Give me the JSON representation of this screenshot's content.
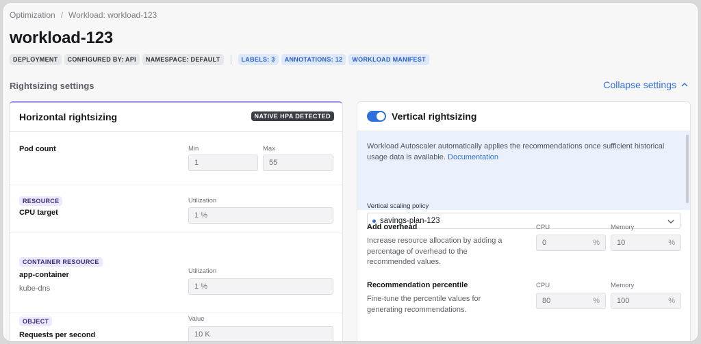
{
  "breadcrumb": {
    "root": "Optimization",
    "separator": "/",
    "current": "Workload: workload-123"
  },
  "title": "workload-123",
  "tags": [
    "DEPLOYMENT",
    "CONFIGURED BY: API",
    "NAMESPACE: DEFAULT"
  ],
  "link_tags": [
    "LABELS: 3",
    "ANNOTATIONS: 12",
    "WORKLOAD MANIFEST"
  ],
  "section_title": "Rightsizing settings",
  "collapse_label": "Collapse settings",
  "horizontal": {
    "title": "Horizontal rightsizing",
    "badge": "NATIVE HPA DETECTED",
    "pod_count": {
      "label": "Pod count",
      "min_label": "Min",
      "min_value": "1",
      "max_label": "Max",
      "max_value": "55"
    },
    "cpu": {
      "pill": "RESOURCE",
      "label": "CPU target",
      "field_label": "Utilization",
      "value": "1",
      "unit": "%"
    },
    "container": {
      "pill": "CONTAINER RESOURCE",
      "label": "app-container",
      "sub": "kube-dns",
      "field_label": "Utilization",
      "value": "1",
      "unit": "%"
    },
    "object": {
      "pill": "OBJECT",
      "label": "Requests per second",
      "field_label": "Value",
      "value": "10",
      "unit": "K"
    }
  },
  "vertical": {
    "title": "Vertical rightsizing",
    "enabled": true,
    "info_text": "Workload Autoscaler automatically applies the recommendations once sufficient historical usage data is available.",
    "info_link": "Documentation",
    "policy_label": "Vertical scaling policy",
    "policy_value": "savings-plan-123",
    "overhead": {
      "label": "Add overhead",
      "desc": "Increase resource allocation by adding a percentage of overhead to the recommended values.",
      "cpu_label": "CPU",
      "cpu_value": "0",
      "memory_label": "Memory",
      "memory_value": "10",
      "unit": "%"
    },
    "percentile": {
      "label": "Recommendation percentile",
      "desc": "Fine-tune the percentile values for generating recommendations.",
      "cpu_label": "CPU",
      "cpu_value": "80",
      "memory_label": "Memory",
      "memory_value": "100",
      "unit": "%"
    }
  },
  "colors": {
    "accent": "#2f6fdb",
    "purple": "#9b8de8",
    "info_bg": "#eaf1fd"
  }
}
